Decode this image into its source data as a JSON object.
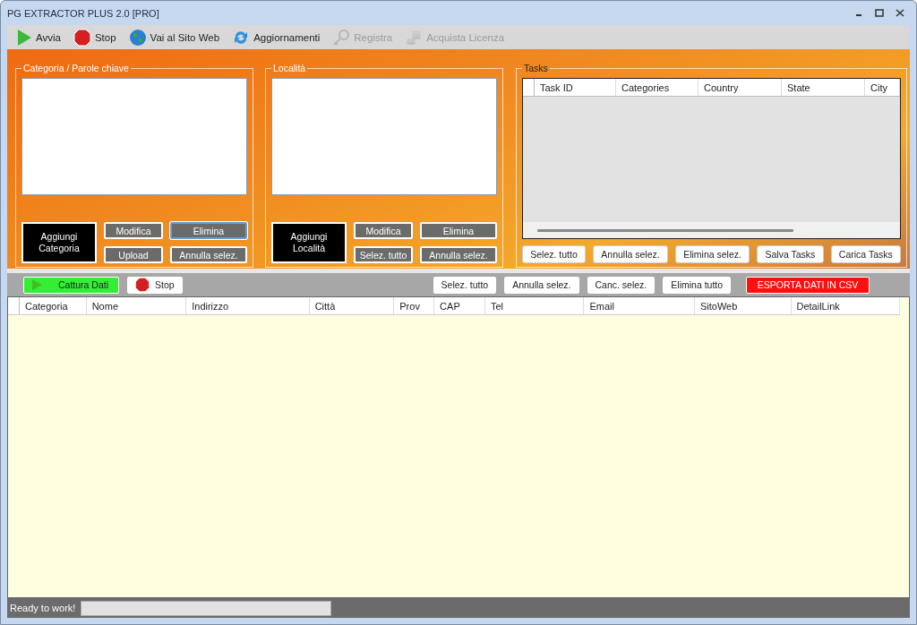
{
  "window": {
    "title": "PG EXTRACTOR PLUS 2.0 [PRO]"
  },
  "toolbar": [
    {
      "kind": "play",
      "label": "Avvia",
      "disabled": false
    },
    {
      "kind": "stop",
      "label": "Stop",
      "disabled": false
    },
    {
      "kind": "globe",
      "label": "Vai al Sito Web",
      "disabled": false
    },
    {
      "kind": "refresh",
      "label": "Aggiornamenti",
      "disabled": false
    },
    {
      "kind": "key",
      "label": "Registra",
      "disabled": true
    },
    {
      "kind": "coins",
      "label": "Acquista Licenza",
      "disabled": true
    }
  ],
  "categories_group": {
    "title": "Categoria / Parole chiave",
    "add_button": "Aggiungi Categoria",
    "buttons": [
      {
        "label": "Modifica",
        "focused": false
      },
      {
        "label": "Elimina",
        "focused": true
      },
      {
        "label": "Upload",
        "focused": false
      },
      {
        "label": "Annulla selez.",
        "focused": false
      }
    ]
  },
  "locations_group": {
    "title": "Località",
    "add_button": "Aggiungi Località",
    "buttons": [
      {
        "label": "Modifica",
        "focused": false
      },
      {
        "label": "Elimina",
        "focused": false
      },
      {
        "label": "Selez. tutto",
        "focused": false
      },
      {
        "label": "Annulla selez.",
        "focused": false
      }
    ]
  },
  "tasks_group": {
    "title": "Tasks",
    "columns": [
      "Task ID",
      "Categories",
      "Country",
      "State",
      "City"
    ],
    "buttons": [
      "Selez. tutto",
      "Annulla selez.",
      "Elimina selez.",
      "Salva Tasks",
      "Carica Tasks"
    ]
  },
  "capture_bar": {
    "buttons": [
      {
        "kind": "capture",
        "label": "Cattura Dati"
      },
      {
        "kind": "stop",
        "label": "Stop"
      },
      {
        "kind": "plain",
        "label": "Selez. tutto"
      },
      {
        "kind": "plain",
        "label": "Annulla selez."
      },
      {
        "kind": "plain",
        "label": "Canc. selez."
      },
      {
        "kind": "plain",
        "label": "Elimina tutto"
      },
      {
        "kind": "export",
        "label": "ESPORTA DATI IN CSV"
      }
    ]
  },
  "results_table": {
    "columns": [
      "Categoria",
      "Nome",
      "Indirizzo",
      "Città",
      "Prov",
      "CAP",
      "Tel",
      "Email",
      "SitoWeb",
      "DetailLink"
    ]
  },
  "status_bar": {
    "text": "Ready to work!",
    "progress": {
      "level": 0
    }
  }
}
